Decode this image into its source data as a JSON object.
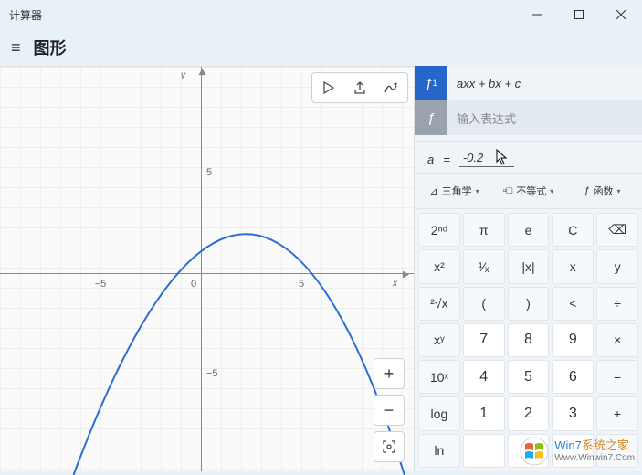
{
  "title": "计算器",
  "header_label": "图形",
  "graph": {
    "y_label": "y",
    "x_label": "x",
    "ticks_x": {
      "neg5": "−5",
      "pos5": "5"
    },
    "ticks_y": {
      "neg5": "−5",
      "pos5": "5"
    },
    "origin": "0"
  },
  "functions": {
    "f1": {
      "badge": "ƒ",
      "sub": "1",
      "expr": "axx + bx + c"
    },
    "fnew": {
      "badge": "ƒ",
      "placeholder": "输入表达式"
    }
  },
  "param": {
    "name": "a",
    "eq": "=",
    "value": "-0.2"
  },
  "modes": {
    "trig_icon": "⊿",
    "trig": "三角学",
    "ineq_icon": "▫□",
    "ineq": "不等式",
    "fn_icon": "ƒ",
    "fn": "函数"
  },
  "keys": {
    "r0": [
      "2ⁿᵈ",
      "π",
      "e",
      "C",
      "⌫"
    ],
    "r1": [
      "x²",
      "¹⁄ₓ",
      "|x|",
      "x",
      "y"
    ],
    "r2": [
      "²√x",
      "(",
      ")",
      "<",
      "÷"
    ],
    "r3": [
      "xʸ",
      "7",
      "8",
      "9",
      "×"
    ],
    "r4": [
      "10ˣ",
      "4",
      "5",
      "6",
      "−"
    ],
    "r5": [
      "log",
      "1",
      "2",
      "3",
      "+"
    ],
    "r6": [
      "ln",
      "",
      "",
      "",
      ""
    ]
  },
  "watermark": {
    "line1_a": "Win7",
    "line1_b": "系统之家",
    "line2": "Www.Winwin7.Com"
  }
}
